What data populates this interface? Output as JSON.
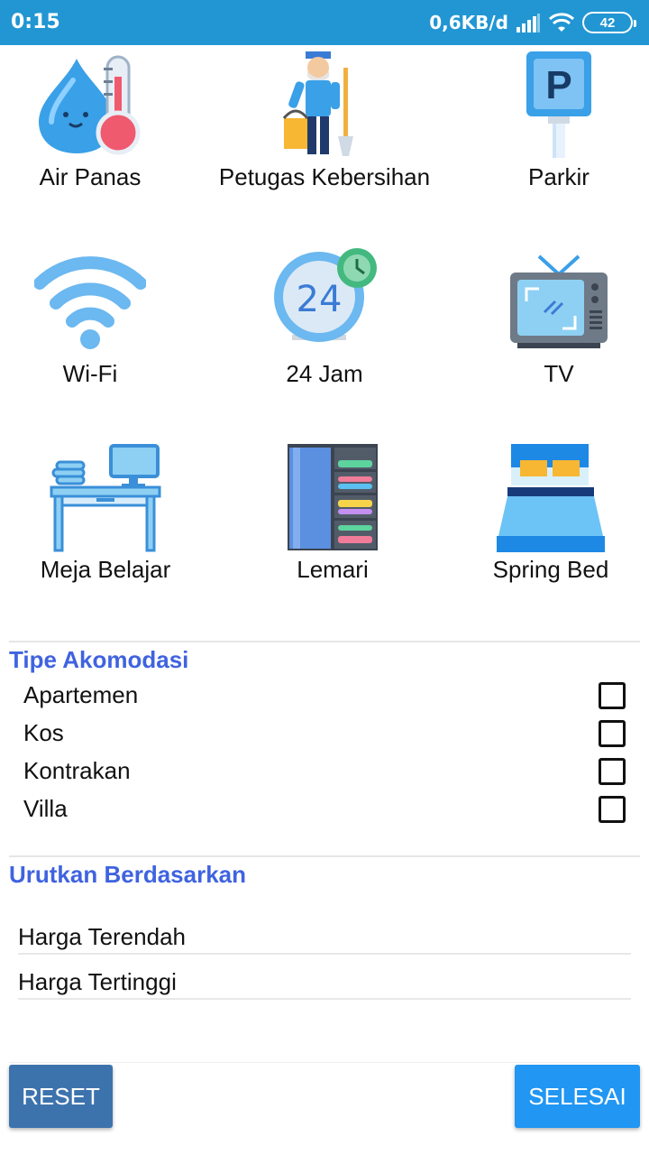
{
  "status_bar": {
    "time": "0:15",
    "network_speed": "0,6KB/d",
    "battery": "42"
  },
  "facilities": [
    {
      "label": "Air Panas",
      "icon": "hot-water-icon"
    },
    {
      "label": "Petugas Kebersihan",
      "icon": "cleaning-staff-icon"
    },
    {
      "label": "Parkir",
      "icon": "parking-icon"
    },
    {
      "label": "Wi-Fi",
      "icon": "wifi-icon"
    },
    {
      "label": "24 Jam",
      "icon": "clock-24-icon"
    },
    {
      "label": "TV",
      "icon": "tv-icon"
    },
    {
      "label": "Meja Belajar",
      "icon": "study-desk-icon"
    },
    {
      "label": "Lemari",
      "icon": "wardrobe-icon"
    },
    {
      "label": "Spring Bed",
      "icon": "bed-icon"
    }
  ],
  "accommodation": {
    "title": "Tipe Akomodasi",
    "options": [
      {
        "label": "Apartemen",
        "checked": false
      },
      {
        "label": "Kos",
        "checked": false
      },
      {
        "label": "Kontrakan",
        "checked": false
      },
      {
        "label": "Villa",
        "checked": false
      }
    ]
  },
  "sort": {
    "title": "Urutkan Berdasarkan",
    "options": [
      "Harga Terendah",
      "Harga Tertinggi"
    ]
  },
  "buttons": {
    "reset": "RESET",
    "done": "SELESAI"
  },
  "colors": {
    "status_bar": "#2196d3",
    "section_title": "#3f63e0",
    "reset_button": "#3d73ad",
    "done_button": "#2196f3"
  }
}
